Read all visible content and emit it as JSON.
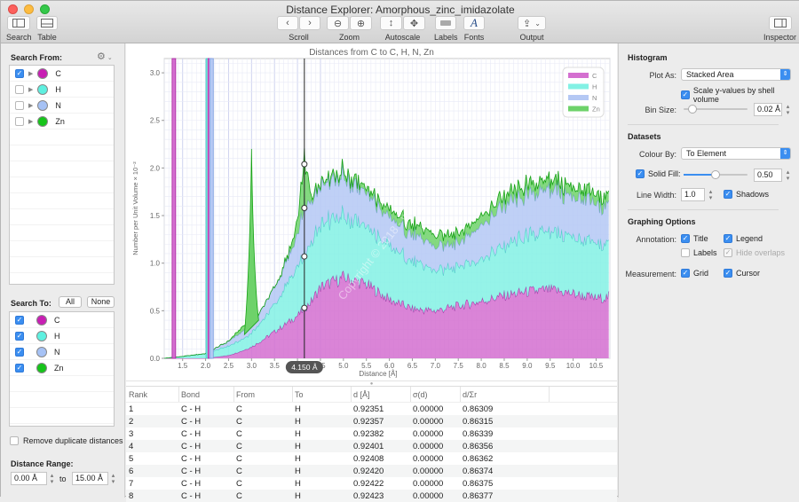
{
  "window": {
    "title": "Distance Explorer: Amorphous_zinc_imidazolate",
    "traffic_lights": {
      "close": "#fc605c",
      "minimize": "#fdbc40",
      "maximize": "#34c84a"
    }
  },
  "toolbar": {
    "search": {
      "label": "Search",
      "icon": "sidebar-left-icon"
    },
    "table": {
      "label": "Table",
      "icon": "table-panel-icon"
    },
    "scroll": {
      "label": "Scroll",
      "left": "‹",
      "right": "›"
    },
    "zoom": {
      "label": "Zoom",
      "out": "⊖",
      "in": "⊕"
    },
    "autoscale": {
      "label": "Autoscale",
      "vertical": "↕",
      "both": "✥"
    },
    "labels": {
      "label": "Labels",
      "icon": "tag-icon"
    },
    "fonts": {
      "label": "Fonts",
      "glyph": "A"
    },
    "output": {
      "label": "Output",
      "glyph": "⇪",
      "chevron": "⌄"
    },
    "inspector": {
      "label": "Inspector",
      "icon": "sidebar-right-icon"
    }
  },
  "left": {
    "search_from": {
      "title": "Search From:",
      "gear": "⚙",
      "items": [
        {
          "label": "C",
          "checked": true,
          "color": "#c81fb4"
        },
        {
          "label": "H",
          "checked": false,
          "color": "#5ef0e0"
        },
        {
          "label": "N",
          "checked": false,
          "color": "#a6c2f5"
        },
        {
          "label": "Zn",
          "checked": false,
          "color": "#16c41a"
        }
      ]
    },
    "search_to": {
      "title": "Search To:",
      "all": "All",
      "none": "None",
      "items": [
        {
          "label": "C",
          "checked": true,
          "color": "#c81fb4"
        },
        {
          "label": "H",
          "checked": true,
          "color": "#5ef0e0"
        },
        {
          "label": "N",
          "checked": true,
          "color": "#a6c2f5"
        },
        {
          "label": "Zn",
          "checked": true,
          "color": "#16c41a"
        }
      ]
    },
    "remove_duplicates": {
      "label": "Remove duplicate distances",
      "checked": false
    },
    "distance_range": {
      "title": "Distance Range:",
      "min": "0.00 Å",
      "to": "to",
      "max": "15.00 Å"
    }
  },
  "chart_data": {
    "type": "area",
    "stacked": true,
    "title": "Distances from C to C, H, N, Zn",
    "xlabel": "Distance [Å]",
    "ylabel": "Number per Unit Volume × 10⁻²",
    "xlim": [
      1.1,
      10.8
    ],
    "ylim": [
      0,
      3.15
    ],
    "xticks": [
      "1.5",
      "2.0",
      "2.5",
      "3.0",
      "3.5",
      "4.0",
      "4.5",
      "5.0",
      "5.5",
      "6.0",
      "6.5",
      "7.0",
      "7.5",
      "8.0",
      "8.5",
      "9.0",
      "9.5",
      "10.0",
      "10.5"
    ],
    "yticks": [
      "0.0",
      "0.5",
      "1.0",
      "1.5",
      "2.0",
      "2.5",
      "3.0"
    ],
    "grid": true,
    "legend": {
      "position": "top-right",
      "entries": [
        {
          "label": "C",
          "color": "#d46fd0"
        },
        {
          "label": "H",
          "color": "#82f1e4"
        },
        {
          "label": "N",
          "color": "#b4c8f4"
        },
        {
          "label": "Zn",
          "color": "#6ed26a"
        }
      ]
    },
    "x": [
      1.1,
      1.5,
      2.0,
      2.5,
      2.8,
      3.0,
      3.2,
      3.5,
      3.8,
      4.0,
      4.15,
      4.3,
      4.5,
      5.0,
      5.5,
      6.0,
      6.5,
      7.0,
      7.5,
      8.0,
      8.5,
      9.0,
      9.5,
      10.0,
      10.5,
      10.8
    ],
    "series": [
      {
        "name": "C",
        "color": "#d46fd0",
        "line": "#a8209e",
        "values": [
          0,
          0,
          0,
          0.03,
          0.08,
          0.12,
          0.18,
          0.28,
          0.38,
          0.45,
          0.52,
          0.6,
          0.75,
          0.85,
          0.78,
          0.62,
          0.52,
          0.5,
          0.55,
          0.6,
          0.66,
          0.7,
          0.72,
          0.68,
          0.63,
          0.65
        ]
      },
      {
        "name": "H",
        "color": "#82f1e4",
        "line": "#3ccfc0",
        "values": [
          0,
          0.02,
          0.05,
          0.1,
          0.12,
          0.15,
          0.2,
          0.28,
          0.42,
          0.5,
          0.55,
          0.62,
          0.68,
          0.65,
          0.6,
          0.55,
          0.5,
          0.42,
          0.42,
          0.45,
          0.52,
          0.58,
          0.6,
          0.6,
          0.55,
          0.58
        ]
      },
      {
        "name": "N",
        "color": "#b4c8f4",
        "line": "#7b9ee0",
        "values": [
          0,
          0,
          0,
          0.05,
          0.08,
          0.1,
          0.12,
          0.18,
          0.25,
          0.35,
          0.5,
          0.45,
          0.42,
          0.4,
          0.35,
          0.3,
          0.28,
          0.25,
          0.25,
          0.35,
          0.42,
          0.42,
          0.45,
          0.42,
          0.42,
          0.4
        ]
      },
      {
        "name": "Zn",
        "color": "#6ed26a",
        "line": "#17a315",
        "values": [
          0,
          0,
          0,
          0,
          0.05,
          0.03,
          0,
          0,
          0.02,
          0.15,
          0.5,
          0.05,
          0.02,
          0.05,
          0.05,
          0.08,
          0.1,
          0.12,
          0.1,
          0.1,
          0.1,
          0.1,
          0.1,
          0.1,
          0.1,
          0.1
        ]
      }
    ],
    "spikes": [
      {
        "x": 1.31,
        "series": "C"
      },
      {
        "x": 2.05,
        "series": "H"
      },
      {
        "x": 2.09,
        "series": "C"
      },
      {
        "x": 2.13,
        "series": "N"
      },
      {
        "x": 3.0,
        "series": "H",
        "peak": 2.2
      }
    ],
    "cursor": {
      "x": 4.15,
      "label": "4.150 Å",
      "points": [
        0.53,
        1.07,
        1.58,
        2.04
      ]
    },
    "watermark": "Copyright © 2018 - www.p30download.com"
  },
  "table": {
    "columns": [
      "Rank",
      "Bond",
      "From",
      "To",
      "d [Å]",
      "σ(d)",
      "d/Σr"
    ],
    "rows": [
      [
        "1",
        "C - H",
        "C",
        "H",
        "0.92351",
        "0.00000",
        "0.86309"
      ],
      [
        "2",
        "C - H",
        "C",
        "H",
        "0.92357",
        "0.00000",
        "0.86315"
      ],
      [
        "3",
        "C - H",
        "C",
        "H",
        "0.92382",
        "0.00000",
        "0.86339"
      ],
      [
        "4",
        "C - H",
        "C",
        "H",
        "0.92401",
        "0.00000",
        "0.86356"
      ],
      [
        "5",
        "C - H",
        "C",
        "H",
        "0.92408",
        "0.00000",
        "0.86362"
      ],
      [
        "6",
        "C - H",
        "C",
        "H",
        "0.92420",
        "0.00000",
        "0.86374"
      ],
      [
        "7",
        "C - H",
        "C",
        "H",
        "0.92422",
        "0.00000",
        "0.86375"
      ],
      [
        "8",
        "C - H",
        "C",
        "H",
        "0.92423",
        "0.00000",
        "0.86377"
      ]
    ]
  },
  "inspector": {
    "histogram": {
      "title": "Histogram",
      "plot_as_label": "Plot As:",
      "plot_as_value": "Stacked Area",
      "scale_label": "Scale y-values by shell volume",
      "scale_checked": true,
      "bin_size_label": "Bin Size:",
      "bin_size_value": "0.02 Å",
      "bin_slider_fraction": 0.08
    },
    "datasets": {
      "title": "Datasets",
      "colour_by_label": "Colour By:",
      "colour_by_value": "To Element",
      "solid_fill_label": "Solid Fill:",
      "solid_fill_checked": true,
      "solid_fill_value": "0.50",
      "solid_fill_fraction": 0.5,
      "line_width_label": "Line Width:",
      "line_width_value": "1.0",
      "shadows_label": "Shadows",
      "shadows_checked": true
    },
    "graphing": {
      "title": "Graphing Options",
      "annotation_label": "Annotation:",
      "title_opt": "Title",
      "legend_opt": "Legend",
      "labels_opt": "Labels",
      "hide_overlaps_opt": "Hide overlaps",
      "measurement_label": "Measurement:",
      "grid_opt": "Grid",
      "cursor_opt": "Cursor"
    }
  }
}
